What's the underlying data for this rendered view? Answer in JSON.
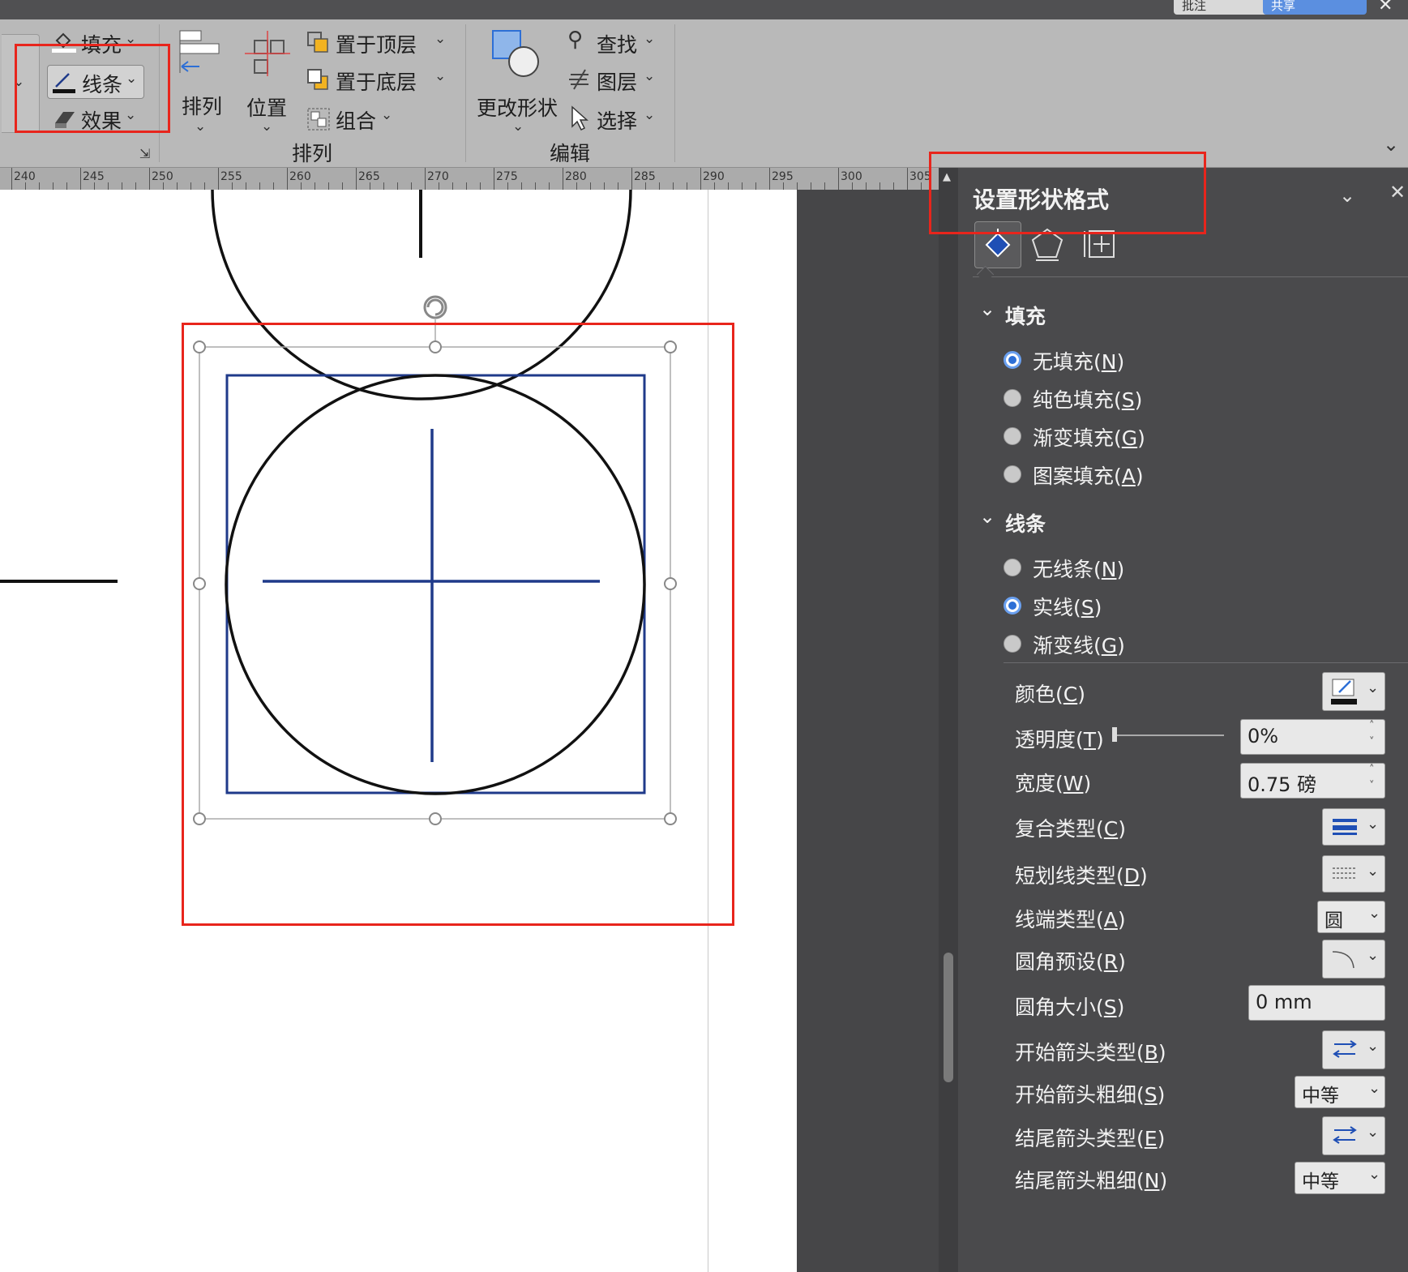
{
  "ribbon": {
    "fill_label": "填充",
    "line_label": "线条",
    "effect_label": "效果",
    "arrange_label": "排列",
    "position_label": "位置",
    "bring_front_label": "置于顶层",
    "send_back_label": "置于底层",
    "group_label": "组合",
    "change_shape_label": "更改形状",
    "find_label": "查找",
    "layer_label": "图层",
    "select_label": "选择",
    "group_arrange_title": "排列",
    "group_edit_title": "编辑"
  },
  "top_buttons": [
    "批注",
    "共享"
  ],
  "ruler": {
    "labels": [
      "240",
      "245",
      "250",
      "255",
      "260",
      "265",
      "270",
      "275",
      "280",
      "285",
      "290",
      "295",
      "300",
      "305"
    ]
  },
  "pane": {
    "title": "设置形状格式",
    "fill_section": "填充",
    "fill_options": [
      {
        "label": "无填充(",
        "key": "N",
        "selected": true
      },
      {
        "label": "纯色填充(",
        "key": "S",
        "selected": false
      },
      {
        "label": "渐变填充(",
        "key": "G",
        "selected": false
      },
      {
        "label": "图案填充(",
        "key": "A",
        "selected": false
      }
    ],
    "line_section": "线条",
    "line_options": [
      {
        "label": "无线条(",
        "key": "N",
        "selected": false
      },
      {
        "label": "实线(",
        "key": "S",
        "selected": true
      },
      {
        "label": "渐变线(",
        "key": "G",
        "selected": false
      }
    ],
    "props": {
      "color": {
        "label": "颜色(",
        "key": "C"
      },
      "transparency": {
        "label": "透明度(",
        "key": "T",
        "value": "0%"
      },
      "width": {
        "label": "宽度(",
        "key": "W",
        "value": "0.75 磅"
      },
      "compound": {
        "label": "复合类型(",
        "key": "C"
      },
      "dash": {
        "label": "短划线类型(",
        "key": "D"
      },
      "cap": {
        "label": "线端类型(",
        "key": "A",
        "value": "圆"
      },
      "corner_preset": {
        "label": "圆角预设(",
        "key": "R"
      },
      "corner_size": {
        "label": "圆角大小(",
        "key": "S",
        "value": "0 mm"
      },
      "begin_arrow_type": {
        "label": "开始箭头类型(",
        "key": "B"
      },
      "begin_arrow_size": {
        "label": "开始箭头粗细(",
        "key": "S",
        "value": "中等"
      },
      "end_arrow_type": {
        "label": "结尾箭头类型(",
        "key": "E"
      },
      "end_arrow_size": {
        "label": "结尾箭头粗细(",
        "key": "N",
        "value": "中等"
      }
    }
  },
  "colors": {
    "highlight_red": "#e8251c",
    "shape_blue": "#1f3a8a",
    "radio_blue": "#2d6fd6"
  }
}
